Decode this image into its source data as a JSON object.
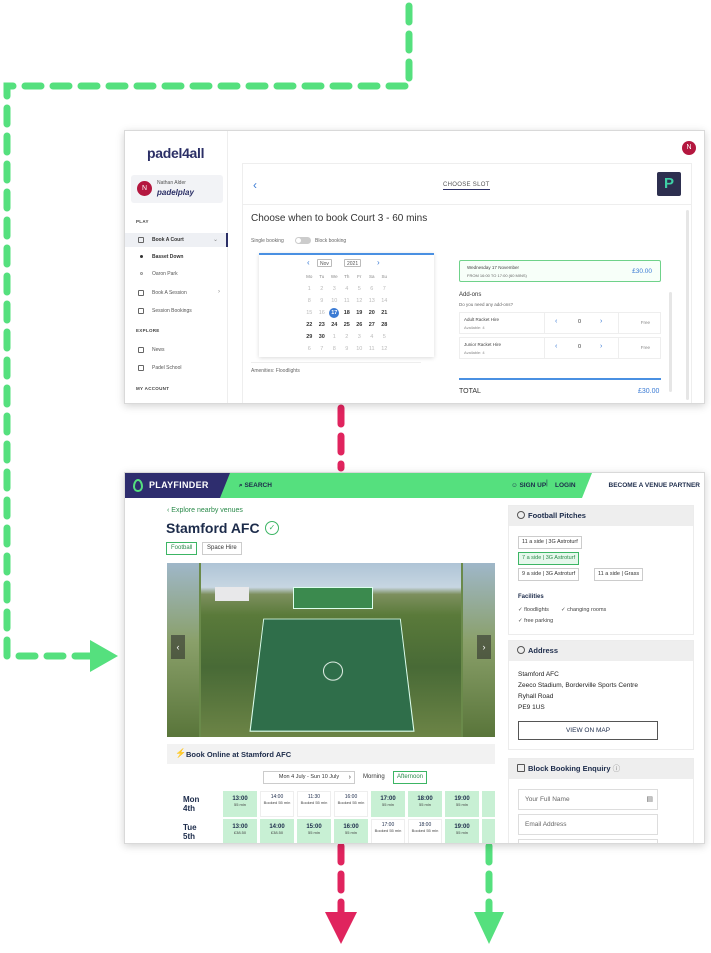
{
  "padel": {
    "logo": "padel4all",
    "user_name": "Nathan Alder",
    "user_brand": "padelplay",
    "avatar_letter": "N",
    "sections": {
      "play": "PLAY",
      "explore": "EXPLORE",
      "account": "MY ACCOUNT"
    },
    "nav": {
      "book_court": "Book A Court",
      "basset": "Basset Down",
      "oaron": "Oaron Park",
      "book_session": "Book A Session",
      "session_bookings": "Session Bookings",
      "news": "News",
      "school": "Padel School"
    },
    "choose_slot": "CHOOSE SLOT",
    "title": "Choose when to book Court 3 - 60 mins",
    "single_booking": "Single booking",
    "block_booking": "Block booking",
    "calendar": {
      "month": "Nov",
      "year": "2021",
      "weekdays": [
        "Mo",
        "Tu",
        "We",
        "Th",
        "Fr",
        "Sa",
        "Su"
      ],
      "weeks": [
        [
          "1",
          "2",
          "3",
          "4",
          "5",
          "6",
          "7"
        ],
        [
          "8",
          "9",
          "10",
          "11",
          "12",
          "13",
          "14"
        ],
        [
          "15",
          "16",
          "17",
          "18",
          "19",
          "20",
          "21"
        ],
        [
          "22",
          "23",
          "24",
          "25",
          "26",
          "27",
          "28"
        ],
        [
          "29",
          "30",
          "1",
          "2",
          "3",
          "4",
          "5"
        ],
        [
          "6",
          "7",
          "8",
          "9",
          "10",
          "11",
          "12"
        ]
      ],
      "selected": "17"
    },
    "amenities": "Amenities: Floodlights",
    "slot_date": "Wednesday 17 November",
    "slot_time": "FROM 16:00 TO 17:00 (60 MINS)",
    "slot_price": "£30.00",
    "addons_title": "Add-ons",
    "addons_question": "Do you need any add-ons?",
    "addons": [
      {
        "name": "Adult Racket Hire",
        "avail": "Available: 4",
        "qty": "0",
        "price": "Free"
      },
      {
        "name": "Junior Racket Hire",
        "avail": "Available: 4",
        "qty": "0",
        "price": "Free"
      }
    ],
    "total_label": "TOTAL",
    "total_value": "£30.00",
    "badge": "N"
  },
  "playfinder": {
    "brand": "PLAYFINDER",
    "search": "SEARCH",
    "signup": "SIGN UP",
    "divider": "|",
    "login": "LOGIN",
    "partner": "BECOME A VENUE PARTNER",
    "explore": "Explore nearby venues",
    "venue": "Stamford AFC",
    "tags": [
      "Football",
      "Space Hire"
    ],
    "book_title": "Book Online at Stamford AFC",
    "week": "Mon 4 July - Sun 10 July",
    "morning": "Morning",
    "afternoon": "Afternoon",
    "days": [
      {
        "name": "Mon",
        "date": "4th",
        "slots": [
          {
            "time": "13:00",
            "sub": "55 min",
            "state": "open"
          },
          {
            "time": "14:00",
            "sub": "Booked 55 min",
            "state": "booked"
          },
          {
            "time": "11:30",
            "sub": "Booked 55 min",
            "state": "booked"
          },
          {
            "time": "16:00",
            "sub": "Booked 55 min",
            "state": "booked"
          },
          {
            "time": "17:00",
            "sub": "55 min",
            "state": "open"
          },
          {
            "time": "18:00",
            "sub": "55 min",
            "state": "open"
          },
          {
            "time": "19:00",
            "sub": "55 min",
            "state": "open"
          }
        ]
      },
      {
        "name": "Tue",
        "date": "5th",
        "slots": [
          {
            "time": "13:00",
            "sub": "£38.50",
            "state": "open"
          },
          {
            "time": "14:00",
            "sub": "£38.50",
            "state": "open"
          },
          {
            "time": "15:00",
            "sub": "55 min",
            "state": "open"
          },
          {
            "time": "16:00",
            "sub": "55 min",
            "state": "open"
          },
          {
            "time": "17:00",
            "sub": "Booked 55 min",
            "state": "booked"
          },
          {
            "time": "18:00",
            "sub": "Booked 55 min",
            "state": "booked"
          },
          {
            "time": "19:00",
            "sub": "55 min",
            "state": "open"
          }
        ]
      }
    ],
    "pitches_title": "Football Pitches",
    "pitches": [
      "11 a side | 3G Astroturf",
      "7 a side | 3G Astroturf",
      "9 a side | 3G Astroturf",
      "11 a side | Grass"
    ],
    "facilities_title": "Facilities",
    "facilities": [
      "floodlights",
      "changing rooms",
      "free parking"
    ],
    "address_title": "Address",
    "address": [
      "Stamford AFC",
      "Zeeco Stadium, Borderville Sports Centre",
      "Ryhall Road",
      "PE9 1US"
    ],
    "map_button": "VIEW ON MAP",
    "enquiry_title": "Block Booking Enquiry",
    "name_placeholder": "Your Full Name",
    "email_placeholder": "Email Address"
  },
  "colors": {
    "green": "#55e07e",
    "navy": "#2e2d6e",
    "pink": "#e0245e",
    "blue": "#3b7bd4"
  }
}
